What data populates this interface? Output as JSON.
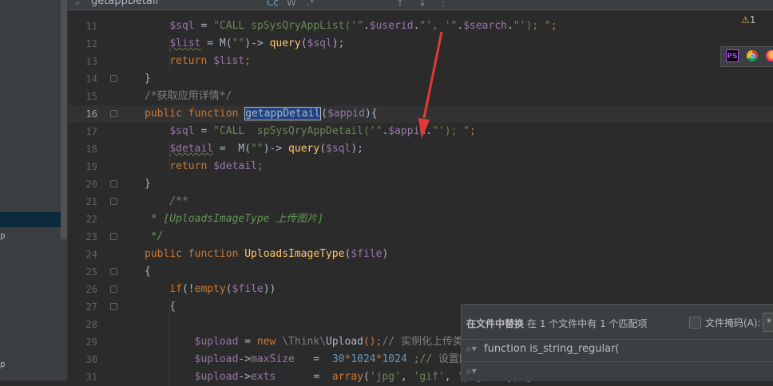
{
  "find_bar": {
    "query": "getappDetail"
  },
  "sidebar": {
    "partial_label": "p",
    "partial_label_2": "p"
  },
  "warnings": {
    "count": "1"
  },
  "browser_icons": [
    "phpstorm-icon",
    "chrome-icon",
    "firefox-icon"
  ],
  "lines": [
    {
      "n": "11",
      "segs": [
        [
          "    ",
          ""
        ],
        [
          "$sql",
          "var"
        ],
        [
          " = ",
          ""
        ],
        [
          "\"CALL spSysQryAppList('\"",
          "str"
        ],
        [
          ".",
          ""
        ],
        [
          "$userid",
          "var"
        ],
        [
          ".",
          ""
        ],
        [
          "\"', '\"",
          "str"
        ],
        [
          ".",
          ""
        ],
        [
          "$search",
          "var"
        ],
        [
          ".",
          ""
        ],
        [
          "\"'); \"",
          "str"
        ],
        [
          ";",
          "kw"
        ]
      ]
    },
    {
      "n": "12",
      "segs": [
        [
          "    ",
          ""
        ],
        [
          "$list",
          "var sq"
        ],
        [
          " = M(",
          ""
        ],
        [
          "\"\"",
          "str"
        ],
        [
          ")-> ",
          ""
        ],
        [
          "query",
          "fn"
        ],
        [
          "(",
          ""
        ],
        [
          "$sql",
          "var"
        ],
        [
          ");",
          ""
        ]
      ]
    },
    {
      "n": "13",
      "segs": [
        [
          "    ",
          ""
        ],
        [
          "return ",
          "kw"
        ],
        [
          "$list",
          "var"
        ],
        [
          ";",
          "kw"
        ]
      ]
    },
    {
      "n": "14",
      "segs": [
        [
          "}",
          ""
        ]
      ]
    },
    {
      "n": "15",
      "segs": [
        [
          "/*获取应用详情*/",
          "cm"
        ]
      ]
    },
    {
      "n": "16",
      "current": true,
      "segs": [
        [
          "public function ",
          "kw"
        ],
        [
          "getappDetail",
          "fn hl"
        ],
        [
          "(",
          ""
        ],
        [
          "$appid",
          "var"
        ],
        [
          "){",
          ""
        ]
      ]
    },
    {
      "n": "17",
      "segs": [
        [
          "    ",
          ""
        ],
        [
          "$sql",
          "var"
        ],
        [
          " = ",
          ""
        ],
        [
          "\"CALL  spSysQryAppDetail('\"",
          "str"
        ],
        [
          ".",
          ""
        ],
        [
          "$appid",
          "var"
        ],
        [
          ".",
          ""
        ],
        [
          "\"'); \"",
          "str"
        ],
        [
          ";",
          "kw"
        ]
      ]
    },
    {
      "n": "18",
      "segs": [
        [
          "    ",
          ""
        ],
        [
          "$detail",
          "var sq"
        ],
        [
          " =  M(",
          ""
        ],
        [
          "\"\"",
          "str"
        ],
        [
          ")-> ",
          ""
        ],
        [
          "query",
          "fn"
        ],
        [
          "(",
          ""
        ],
        [
          "$sql",
          "var"
        ],
        [
          ");",
          ""
        ]
      ]
    },
    {
      "n": "19",
      "segs": [
        [
          "    ",
          ""
        ],
        [
          "return ",
          "kw"
        ],
        [
          "$detail",
          "var"
        ],
        [
          ";",
          "kw"
        ]
      ]
    },
    {
      "n": "20",
      "segs": [
        [
          "}",
          ""
        ]
      ]
    },
    {
      "n": "21",
      "segs": [
        [
          "    ",
          ""
        ],
        [
          "/**",
          "doc"
        ]
      ]
    },
    {
      "n": "22",
      "segs": [
        [
          " * [UploadsImageType 上传图片]",
          "doc"
        ]
      ]
    },
    {
      "n": "23",
      "segs": [
        [
          " */",
          "doc"
        ]
      ]
    },
    {
      "n": "24",
      "segs": [
        [
          "public function ",
          "kw"
        ],
        [
          "UploadsImageType",
          "fn"
        ],
        [
          "(",
          ""
        ],
        [
          "$file",
          "var"
        ],
        [
          ")",
          ""
        ]
      ]
    },
    {
      "n": "25",
      "segs": [
        [
          "{",
          ""
        ]
      ]
    },
    {
      "n": "26",
      "segs": [
        [
          "    ",
          ""
        ],
        [
          "if",
          "kw"
        ],
        [
          "(!",
          ""
        ],
        [
          "empty",
          "kw"
        ],
        [
          "(",
          ""
        ],
        [
          "$file",
          "var"
        ],
        [
          "))",
          ""
        ]
      ]
    },
    {
      "n": "27",
      "segs": [
        [
          "    ",
          ""
        ],
        [
          "{",
          ""
        ]
      ]
    },
    {
      "n": "28",
      "segs": [
        [
          "",
          ""
        ]
      ]
    },
    {
      "n": "29",
      "segs": [
        [
          "        ",
          ""
        ],
        [
          "$upload",
          "var"
        ],
        [
          " = ",
          ""
        ],
        [
          "new ",
          "kw"
        ],
        [
          "\\Think\\",
          "cm"
        ],
        [
          "Upload",
          ""
        ],
        [
          "();",
          "kw"
        ],
        [
          "// 实例化上传类",
          "cm"
        ]
      ]
    },
    {
      "n": "30",
      "segs": [
        [
          "        ",
          ""
        ],
        [
          "$upload",
          "var"
        ],
        [
          "->",
          ""
        ],
        [
          "maxSize",
          "var"
        ],
        [
          "   =  ",
          ""
        ],
        [
          "30",
          "num"
        ],
        [
          "*",
          "kw"
        ],
        [
          "1024",
          "num"
        ],
        [
          "*",
          "kw"
        ],
        [
          "1024 ",
          "num"
        ],
        [
          ";",
          "kw"
        ],
        [
          "// 设置附件上传大小",
          "cm"
        ]
      ]
    },
    {
      "n": "31",
      "segs": [
        [
          "        ",
          ""
        ],
        [
          "$upload",
          "var"
        ],
        [
          "->",
          ""
        ],
        [
          "exts",
          "var"
        ],
        [
          "      =  ",
          ""
        ],
        [
          "array",
          "kw"
        ],
        [
          "(",
          ""
        ],
        [
          "'jpg'",
          "str"
        ],
        [
          ", ",
          ""
        ],
        [
          "'gif'",
          "str"
        ],
        [
          ", ",
          ""
        ],
        [
          "'png'",
          "str"
        ],
        [
          ", ",
          ""
        ],
        [
          "'jpeg'",
          "str"
        ],
        [
          ");",
          ""
        ]
      ]
    }
  ],
  "replace_panel": {
    "title": "在文件中替换",
    "summary": "在 1 个文件中有 1 个匹配项",
    "mask_label": "文件掩码(A):",
    "mask_value": "*",
    "search_value": "function is_string_regular(",
    "replace_value": ""
  },
  "colors": {
    "arrow": "#e53935",
    "selection": "#214283"
  }
}
